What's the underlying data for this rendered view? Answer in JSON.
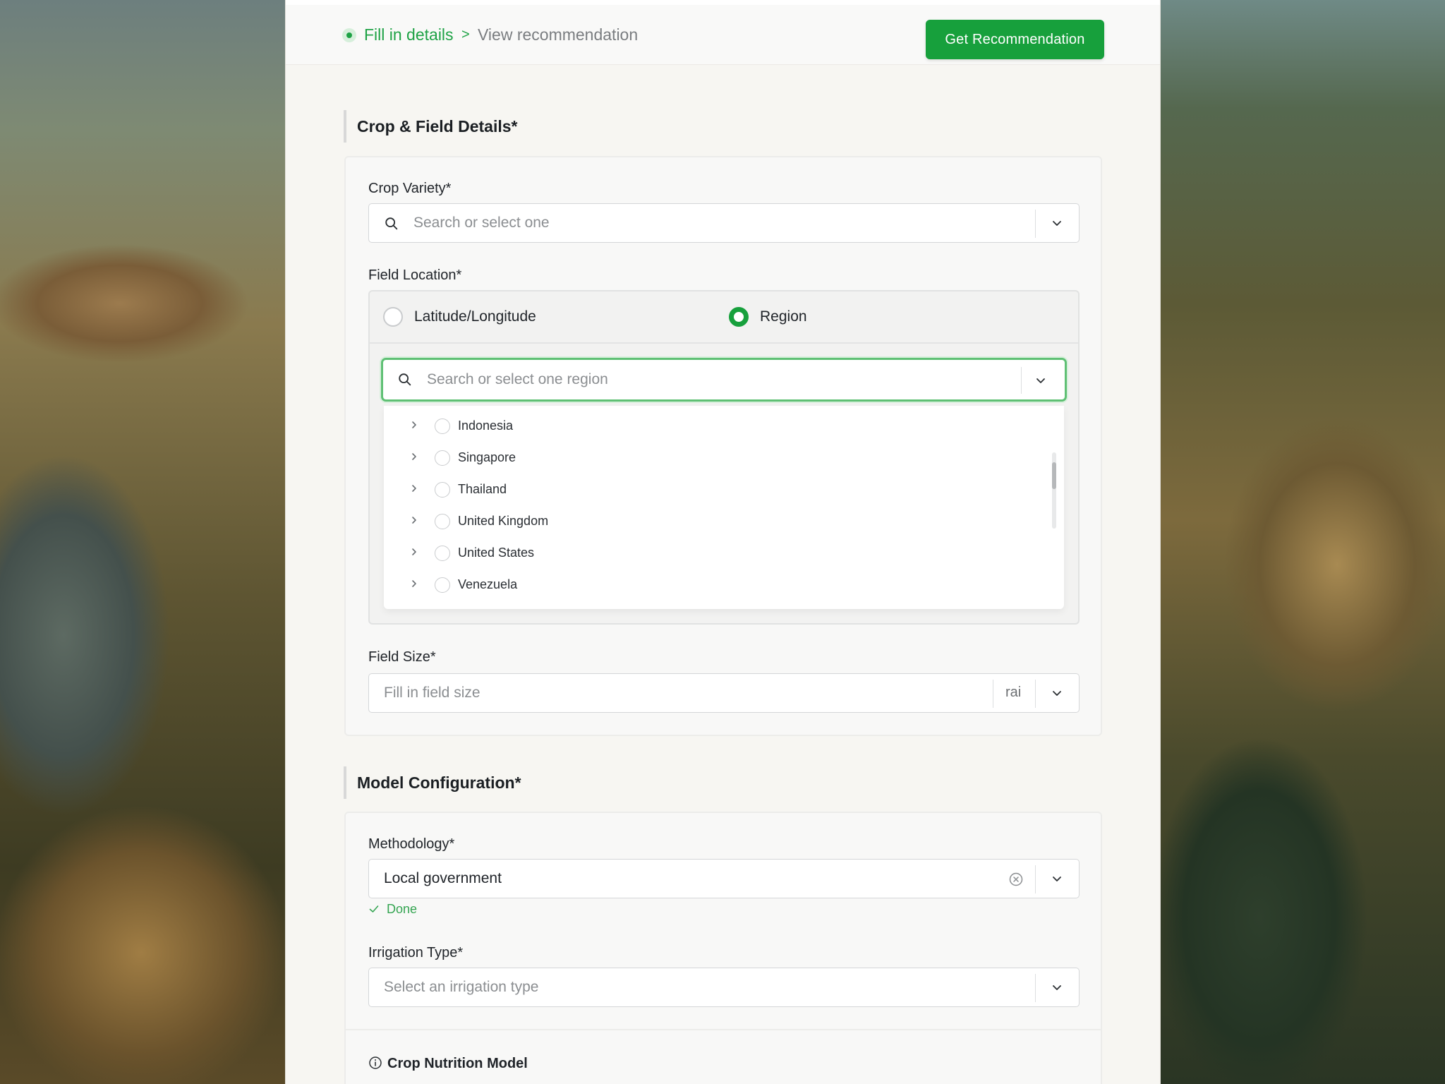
{
  "stepper": {
    "active": "Fill in details",
    "separator": ">",
    "next": "View recommendation"
  },
  "header": {
    "cta_label": "Get Recommendation"
  },
  "colors": {
    "accent": "#17a03c",
    "panel_bg": "#f7f6f2"
  },
  "crop_field": {
    "title": "Crop & Field Details*",
    "crop_variety": {
      "label": "Crop Variety*",
      "placeholder": "Search or select one"
    },
    "field_location": {
      "label": "Field Location*",
      "options": [
        "Latitude/Longitude",
        "Region"
      ],
      "selected": "Region",
      "region_search": {
        "placeholder": "Search or select one region"
      },
      "regions": [
        "Indonesia",
        "Singapore",
        "Thailand",
        "United Kingdom",
        "United States",
        "Venezuela"
      ]
    },
    "field_size": {
      "label": "Field Size*",
      "placeholder": "Fill in field size",
      "unit": "rai"
    }
  },
  "model_config": {
    "title": "Model Configuration*",
    "methodology": {
      "label": "Methodology*",
      "value": "Local government",
      "status": "Done"
    },
    "irrigation": {
      "label": "Irrigation Type*",
      "placeholder": "Select an irrigation type"
    },
    "nutrition": {
      "title": "Crop Nutrition Model"
    }
  },
  "icons": {
    "search": "search-icon",
    "chevron": "chevron-down-icon",
    "clear": "clear-icon",
    "expand": "chevron-right-icon",
    "check": "check-icon",
    "info": "info-icon"
  }
}
